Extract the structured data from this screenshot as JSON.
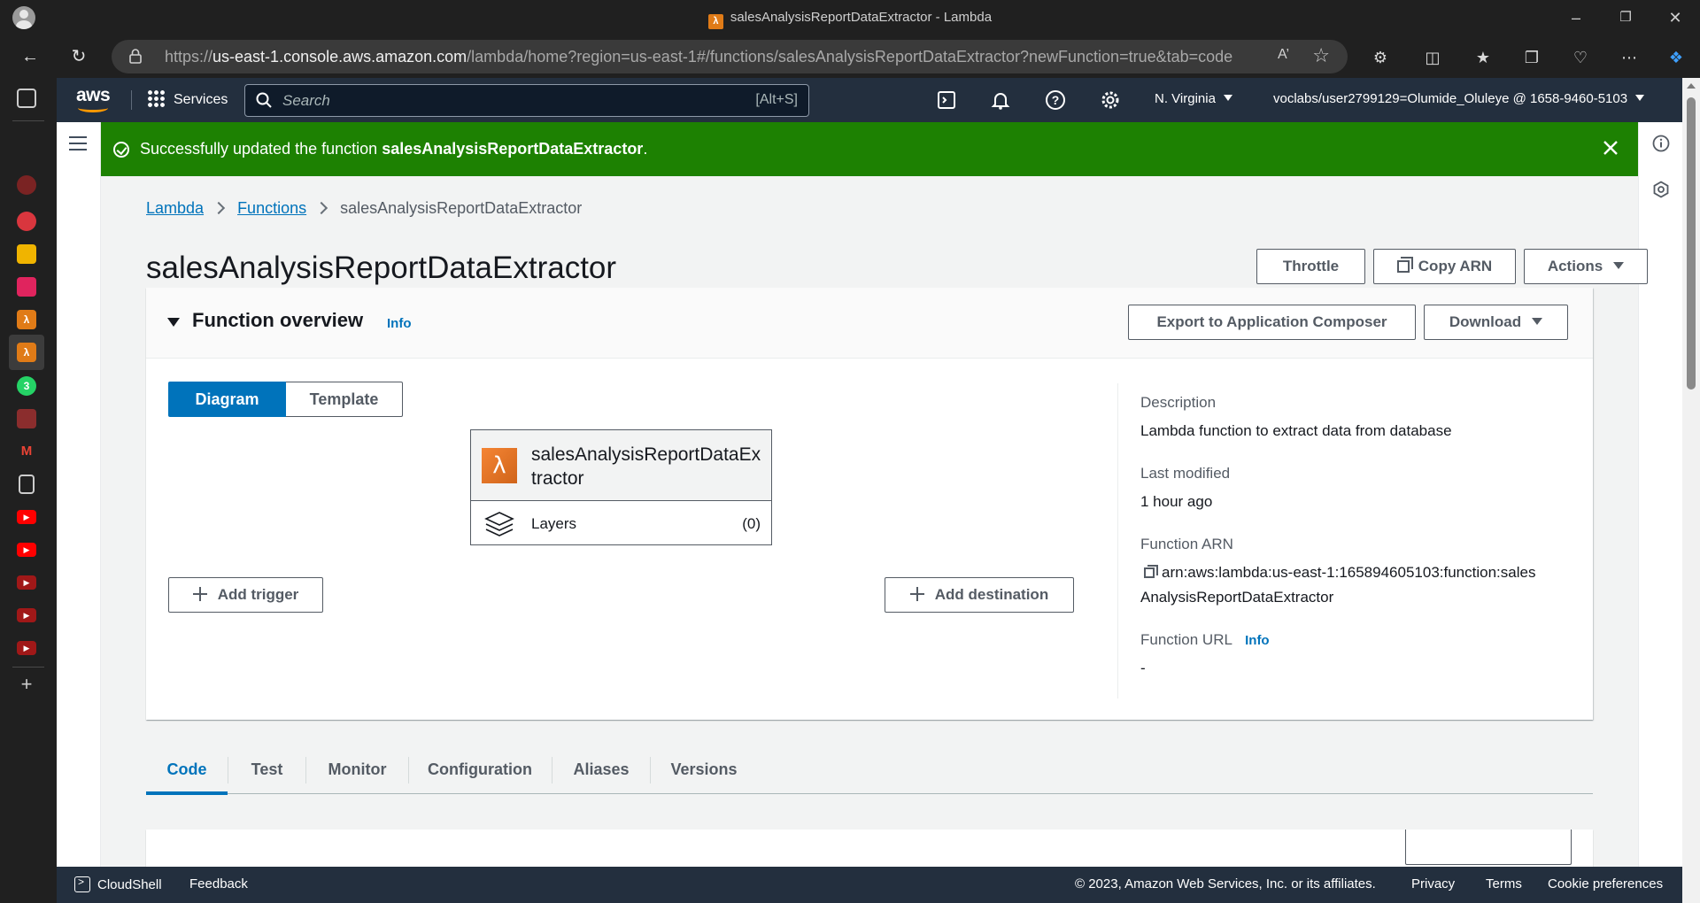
{
  "browser": {
    "tab_title": "salesAnalysisReportDataExtractor - Lambda",
    "url_prefix": "https://",
    "url_host": "us-east-1.console.aws.amazon.com",
    "url_rest": "/lambda/home?region=us-east-1#/functions/salesAnalysisReportDataExtractor?newFunction=true&tab=code"
  },
  "awsnav": {
    "services_label": "Services",
    "search_placeholder": "Search",
    "search_shortcut": "[Alt+S]",
    "region": "N. Virginia",
    "account": "voclabs/user2799129=Olumide_Oluleye @ 1658-9460-5103"
  },
  "flash": {
    "message_prefix": "Successfully updated the function ",
    "function_name": "salesAnalysisReportDataExtractor",
    "message_suffix": "."
  },
  "breadcrumb": {
    "lambda": "Lambda",
    "functions": "Functions",
    "current": "salesAnalysisReportDataExtractor"
  },
  "header": {
    "title": "salesAnalysisReportDataExtractor",
    "throttle": "Throttle",
    "copy_arn": "Copy ARN",
    "actions": "Actions"
  },
  "overview": {
    "title": "Function overview",
    "info": "Info",
    "export": "Export to Application Composer",
    "download": "Download",
    "view_diagram": "Diagram",
    "view_template": "Template",
    "function_box_name": "salesAnalysisReportDataExtractor",
    "layers_label": "Layers",
    "layers_count": "(0)",
    "add_trigger": "Add trigger",
    "add_destination": "Add destination",
    "description_label": "Description",
    "description_value": "Lambda function to extract data from database",
    "last_modified_label": "Last modified",
    "last_modified_value": "1 hour ago",
    "arn_label": "Function ARN",
    "arn_line1": "arn:aws:lambda:us-east-1:165894605103:function:sales",
    "arn_line2": "AnalysisReportDataExtractor",
    "url_label": "Function URL",
    "url_info": "Info",
    "url_value": "-"
  },
  "tabs": [
    "Code",
    "Test",
    "Monitor",
    "Configuration",
    "Aliases",
    "Versions"
  ],
  "footer": {
    "cloudshell": "CloudShell",
    "feedback": "Feedback",
    "copyright": "© 2023, Amazon Web Services, Inc. or its affiliates.",
    "privacy": "Privacy",
    "terms": "Terms",
    "cookies": "Cookie preferences"
  },
  "colors": {
    "success_green": "#1d8102",
    "aws_nav": "#232f3e",
    "link_blue": "#0073bb",
    "lambda_orange": "#e07b17"
  }
}
